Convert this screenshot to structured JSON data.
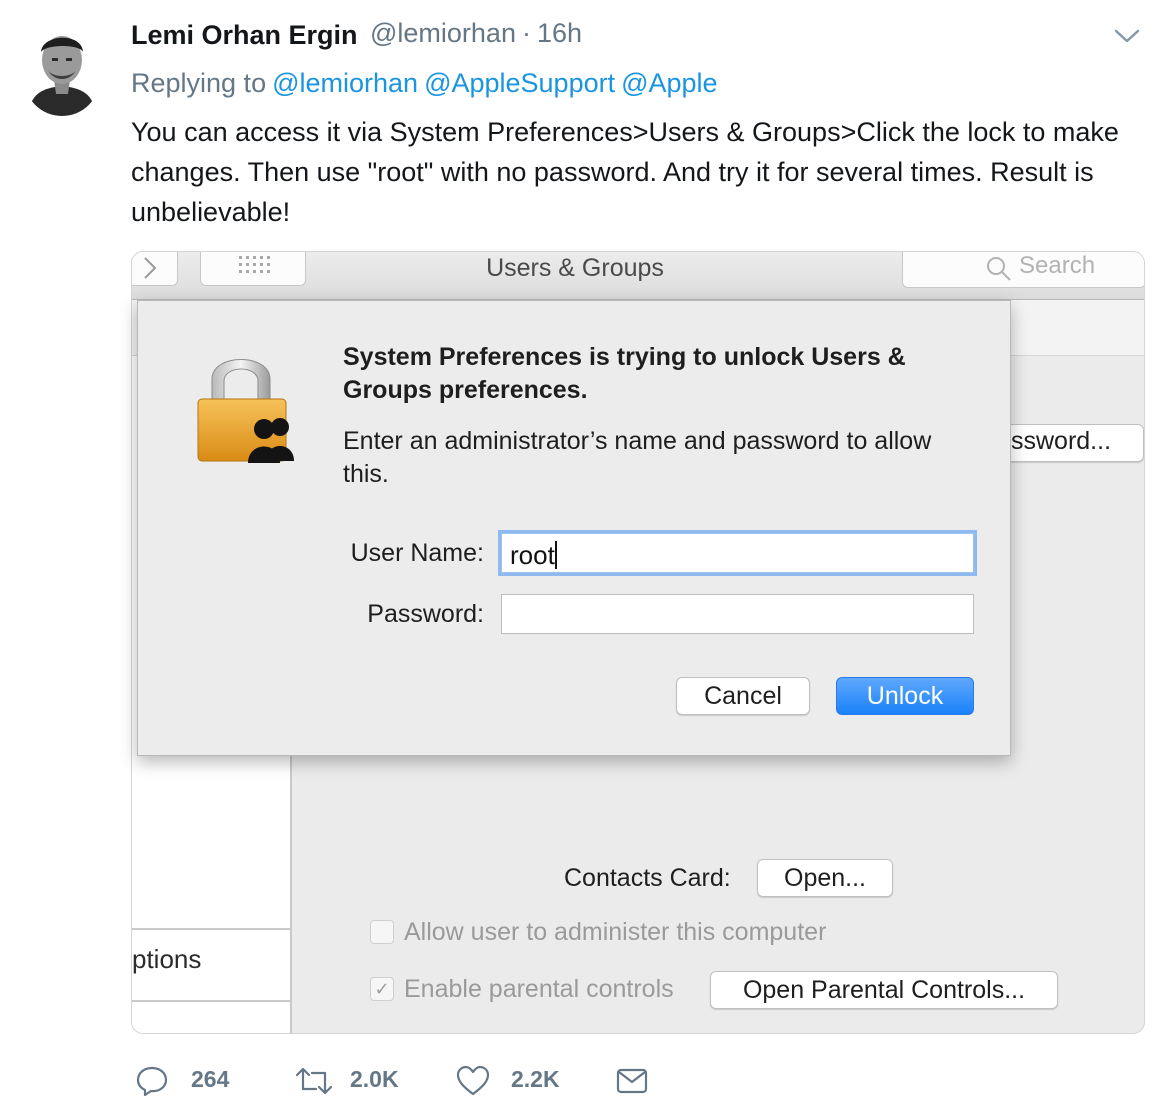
{
  "tweet": {
    "author_name": "Lemi Orhan Ergin",
    "author_handle": "@lemiorhan",
    "separator": "·",
    "time": "16h",
    "replying_prefix": "Replying to",
    "replying_mentions": [
      "@lemiorhan",
      "@AppleSupport",
      "@Apple"
    ],
    "text": "You can access it via System Preferences>Users & Groups>Click the lock to make changes. Then use \"root\" with no password. And try it for several times. Result is unbelievable!",
    "icons": {
      "menu": "chevron-down-icon",
      "avatar": "profile-photo"
    }
  },
  "screenshot": {
    "window_title": "Users & Groups",
    "search_placeholder": "Search",
    "partial_button_password": "ssword...",
    "sidebar_partial_label": "ptions",
    "contacts_card_label": "Contacts Card:",
    "contacts_open_button": "Open...",
    "allow_admin_label": "Allow user to administer this computer",
    "allow_admin_checked": false,
    "parental_controls_label": "Enable parental controls",
    "parental_controls_checked": true,
    "open_parental_button": "Open Parental Controls...",
    "dialog": {
      "title": "System Preferences is trying to unlock Users & Groups preferences.",
      "message": "Enter an administrator’s name and password to allow this.",
      "username_label": "User Name:",
      "username_value": "root",
      "password_label": "Password:",
      "password_value": "",
      "cancel_button": "Cancel",
      "unlock_button": "Unlock",
      "accent_color": "#1a82fa"
    }
  },
  "actions": {
    "reply_count": "264",
    "retweet_count": "2.0K",
    "like_count": "2.2K",
    "icons": [
      "reply-icon",
      "retweet-icon",
      "like-icon",
      "message-icon"
    ]
  }
}
